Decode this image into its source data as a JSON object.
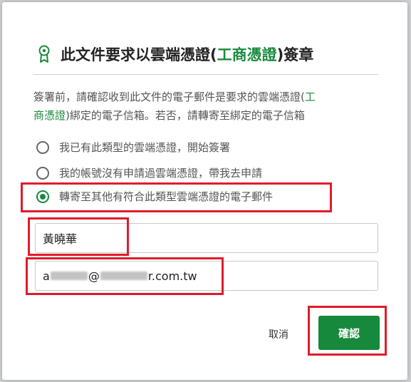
{
  "dialog": {
    "title_prefix": "此文件要求以雲端憑證(",
    "title_highlight": "工商憑證",
    "title_suffix": ")簽章",
    "desc_line1_prefix": "簽署前，請確認收到此文件的電子郵件是要求的雲端憑證(",
    "desc_line1_highlight": "工",
    "desc_line2_highlight": "商憑證",
    "desc_line2_suffix": ")綁定的電子信箱。若否，請轉寄至綁定的電子信箱",
    "options": [
      {
        "label": "我已有此類型的雲端憑證，開始簽署",
        "checked": false
      },
      {
        "label": "我的帳號沒有申請過雲端憑證，帶我去申請",
        "checked": false
      },
      {
        "label": "轉寄至其他有符合此類型雲端憑證的電子郵件",
        "checked": true
      }
    ],
    "name_value": "黃曉華",
    "email_prefix": "a",
    "email_at": "@",
    "email_suffix": "r.com.tw",
    "cancel_label": "取消",
    "confirm_label": "確認"
  },
  "colors": {
    "accent": "#1a8a3e",
    "confirm_bg": "#17893c",
    "highlight_box": "#e01b2c",
    "backdrop": "#cfd1d3"
  },
  "icons": {
    "title": "certificate-award-icon"
  }
}
